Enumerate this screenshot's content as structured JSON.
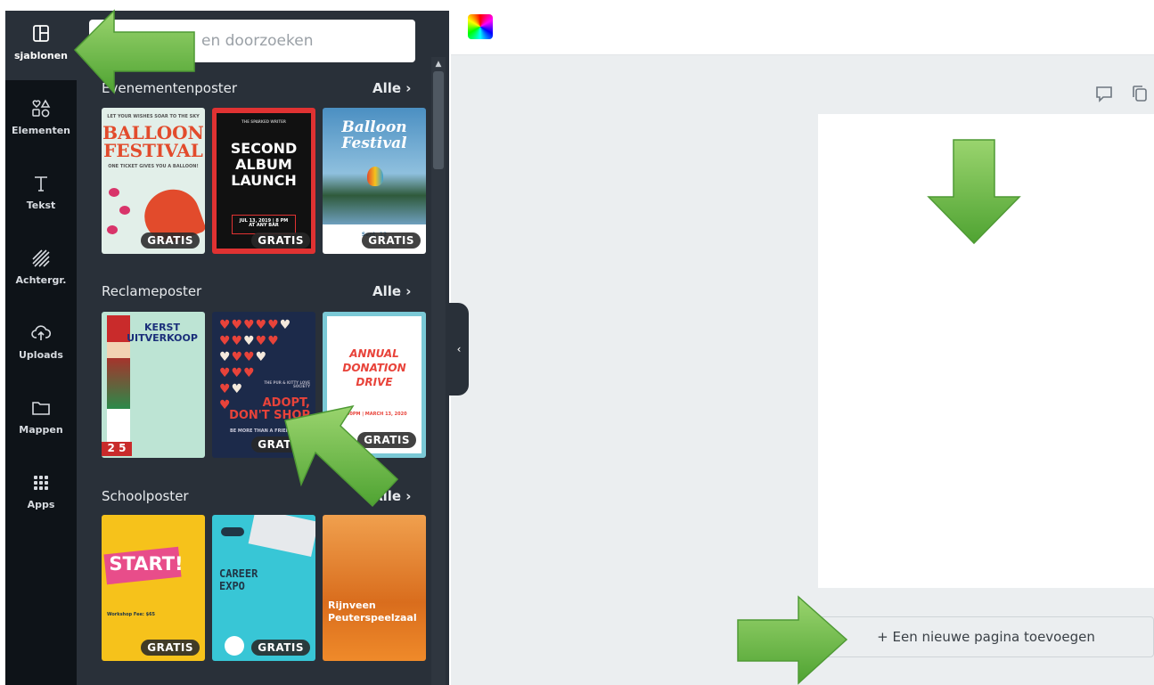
{
  "sidebar": {
    "items": [
      {
        "label": "sjablonen",
        "icon": "template-layout-icon",
        "active": true
      },
      {
        "label": "Elementen",
        "icon": "shapes-icon",
        "active": false
      },
      {
        "label": "Tekst",
        "icon": "text-t-icon",
        "active": false
      },
      {
        "label": "Achtergr.",
        "icon": "background-stripes-icon",
        "active": false
      },
      {
        "label": "Uploads",
        "icon": "cloud-upload-icon",
        "active": false
      },
      {
        "label": "Mappen",
        "icon": "folder-icon",
        "active": false
      },
      {
        "label": "Apps",
        "icon": "apps-grid-icon",
        "active": false
      }
    ]
  },
  "panel": {
    "search_placeholder": "en doorzoeken",
    "badge_label": "GRATIS",
    "sections": [
      {
        "title": "Evenementenposter",
        "all_label": "Alle  ›",
        "posters": [
          {
            "lines": [
              "BALLOON",
              "FESTIVAL"
            ],
            "topline": "LET YOUR WISHES SOAR TO THE SKY",
            "subline": "ONE TICKET GIVES YOU A BALLOON!",
            "bg": "#e2efe9",
            "fg": "#e24b2c"
          },
          {
            "lines": [
              "SECOND",
              "ALBUM",
              "LAUNCH"
            ],
            "topline": "THE SPARKED WRITER",
            "subline": "JUL 13, 2019 | 8 PM\nAT ANY BAR",
            "bg": "#111111",
            "fg": "#ffffff",
            "border": "#e03232"
          },
          {
            "lines": [
              "Balloon",
              "Festival"
            ],
            "topline": "",
            "subline": "Sept. 12",
            "bg": "#3d7ba8",
            "fg": "#ffffff"
          }
        ]
      },
      {
        "title": "Reclameposter",
        "all_label": "Alle  ›",
        "posters": [
          {
            "lines": [
              "KERST",
              "UITVERKOOP"
            ],
            "topline": "",
            "subline": "2 5",
            "bg": "#bde4d4",
            "fg": "#1b2f7a"
          },
          {
            "lines": [
              "ADOPT,",
              "DON'T SHOP"
            ],
            "topline": "THE PUR & KITTY LOVE SOCIETY",
            "subline": "BE MORE THAN A FRIEND—",
            "bg": "#1c2a4a",
            "fg": "#e8433a"
          },
          {
            "lines": [
              "ANNUAL",
              "DONATION",
              "DRIVE"
            ],
            "topline": "",
            "subline": "2:00PM | MARCH 13, 2020",
            "bg": "#ffffff",
            "fg": "#e8433a"
          }
        ]
      },
      {
        "title": "Schoolposter",
        "all_label": "Alle  ›",
        "posters": [
          {
            "lines": [
              "START!"
            ],
            "topline": "",
            "subline": "Workshop Fee: $65",
            "bg": "#f6c21b",
            "fg": "#ffffff"
          },
          {
            "lines": [
              "CAREER",
              "EXPO"
            ],
            "topline": "",
            "subline": "",
            "bg": "#38c6d6",
            "fg": "#203646"
          },
          {
            "lines": [
              "Rijnveen",
              "Peuterspeelzaal"
            ],
            "topline": "",
            "subline": "",
            "bg": "#ef8a2a",
            "fg": "#ffffff"
          }
        ]
      }
    ]
  },
  "main": {
    "add_page_label": "+ Een nieuwe pagina toevoegen",
    "comment_icon": "comment-icon",
    "duplicate_icon": "duplicate-page-icon"
  },
  "colors": {
    "rail_bg": "#0e1318",
    "panel_bg": "#293039",
    "canvas_bg": "#ebeef0",
    "arrow_green": "#6cc04a"
  }
}
